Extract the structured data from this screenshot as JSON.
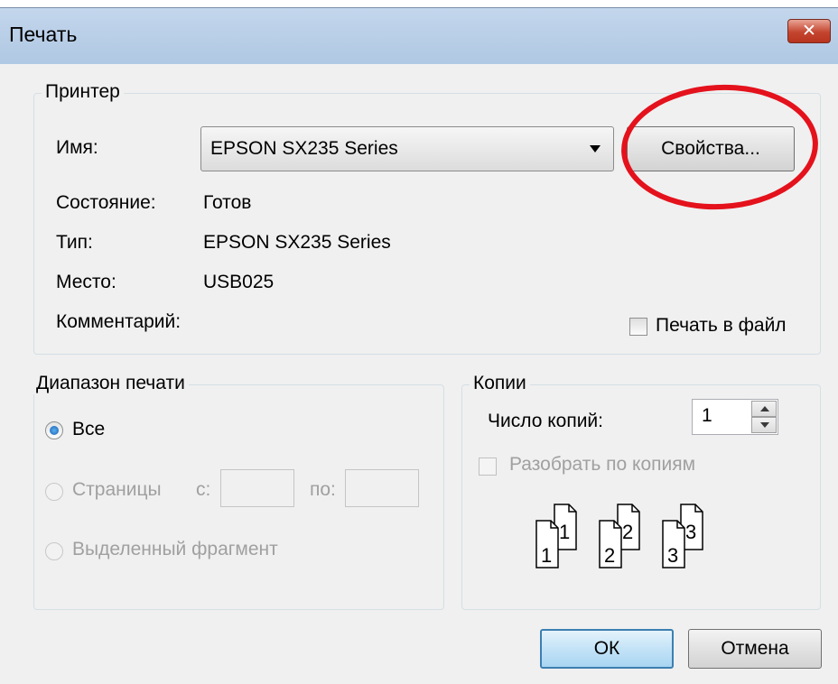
{
  "window": {
    "title": "Печать",
    "close_icon": "close-icon"
  },
  "printer": {
    "legend": "Принтер",
    "name_label": "Имя:",
    "name_value": "EPSON SX235 Series",
    "properties_button": "Свойства...",
    "status_label": "Состояние:",
    "status_value": "Готов",
    "type_label": "Тип:",
    "type_value": "EPSON SX235 Series",
    "location_label": "Место:",
    "location_value": "USB025",
    "comment_label": "Комментарий:",
    "print_to_file_label": "Печать в файл",
    "print_to_file_checked": false
  },
  "range": {
    "legend": "Диапазон печати",
    "all_label": "Все",
    "all_selected": true,
    "pages_label": "Страницы",
    "from_label": "с:",
    "to_label": "по:",
    "selection_label": "Выделенный фрагмент"
  },
  "copies": {
    "legend": "Копии",
    "count_label": "Число копий:",
    "count_value": "1",
    "collate_label": "Разобрать по копиям",
    "collate_checked": false,
    "collate_icon": "collate-pages-icon",
    "collate_pages": [
      {
        "back": "1",
        "front": "1"
      },
      {
        "back": "2",
        "front": "2"
      },
      {
        "back": "3",
        "front": "3"
      }
    ]
  },
  "buttons": {
    "ok": "ОК",
    "cancel": "Отмена"
  },
  "annotation": {
    "highlight_color": "#e4121c"
  }
}
